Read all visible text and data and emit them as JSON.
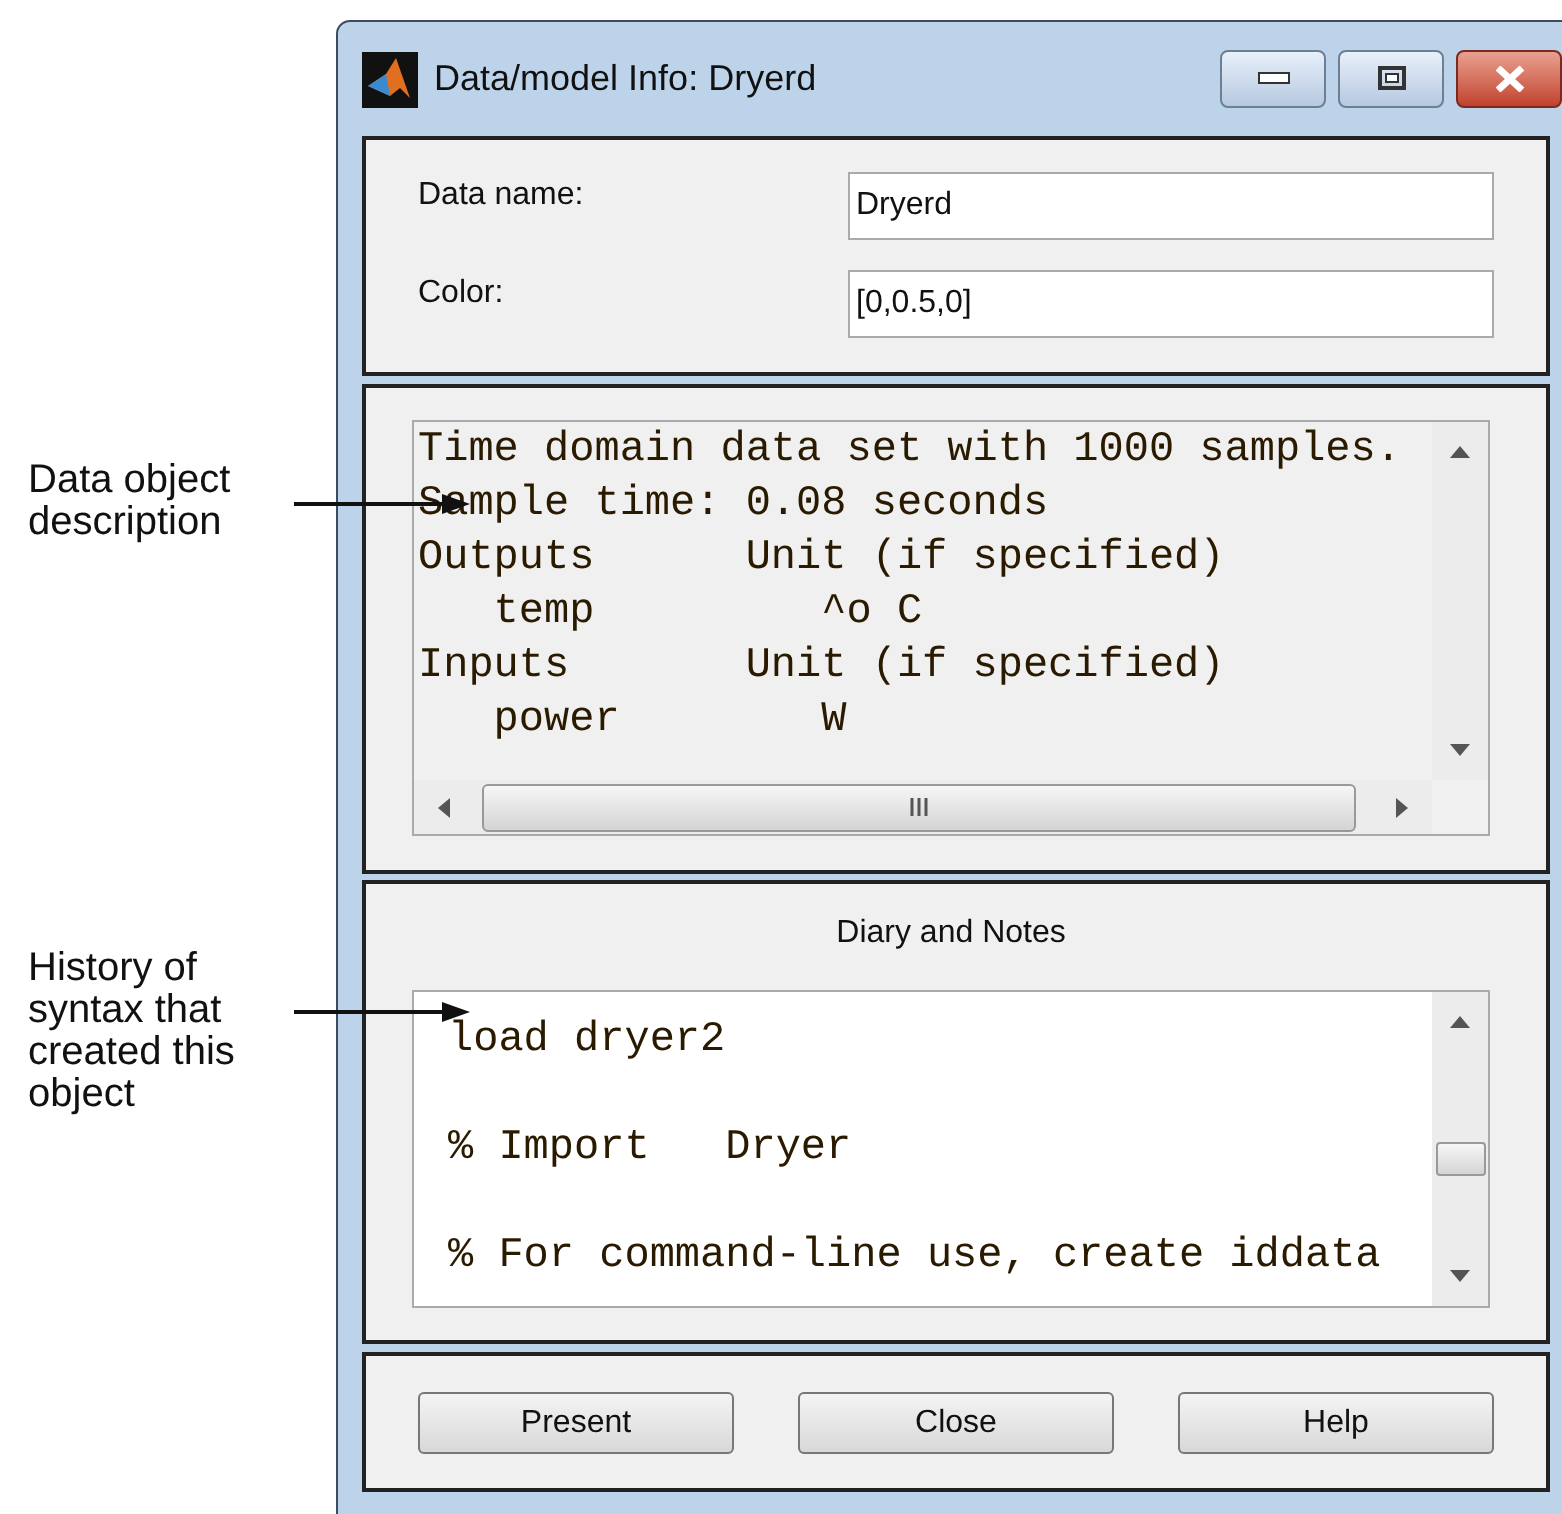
{
  "annotations": [
    {
      "text": "Data object description"
    },
    {
      "text": "History of syntax that created this object"
    }
  ],
  "window": {
    "title": "Data/model Info: Dryerd"
  },
  "fields": [
    {
      "label": "Data name:",
      "value": "Dryerd"
    },
    {
      "label": "Color:",
      "value": "[0,0.5,0]"
    }
  ],
  "description": {
    "lines": [
      "Time domain data set with 1000 samples.",
      "Sample time: 0.08 seconds",
      "Outputs      Unit (if specified)",
      "   temp         ^o C",
      "Inputs       Unit (if specified)",
      "   power        W"
    ]
  },
  "diary": {
    "title": "Diary and Notes",
    "lines": [
      "load dryer2",
      "% Import   Dryer",
      "% For command-line use, create iddata"
    ]
  },
  "buttons": [
    "Present",
    "Close",
    "Help"
  ]
}
